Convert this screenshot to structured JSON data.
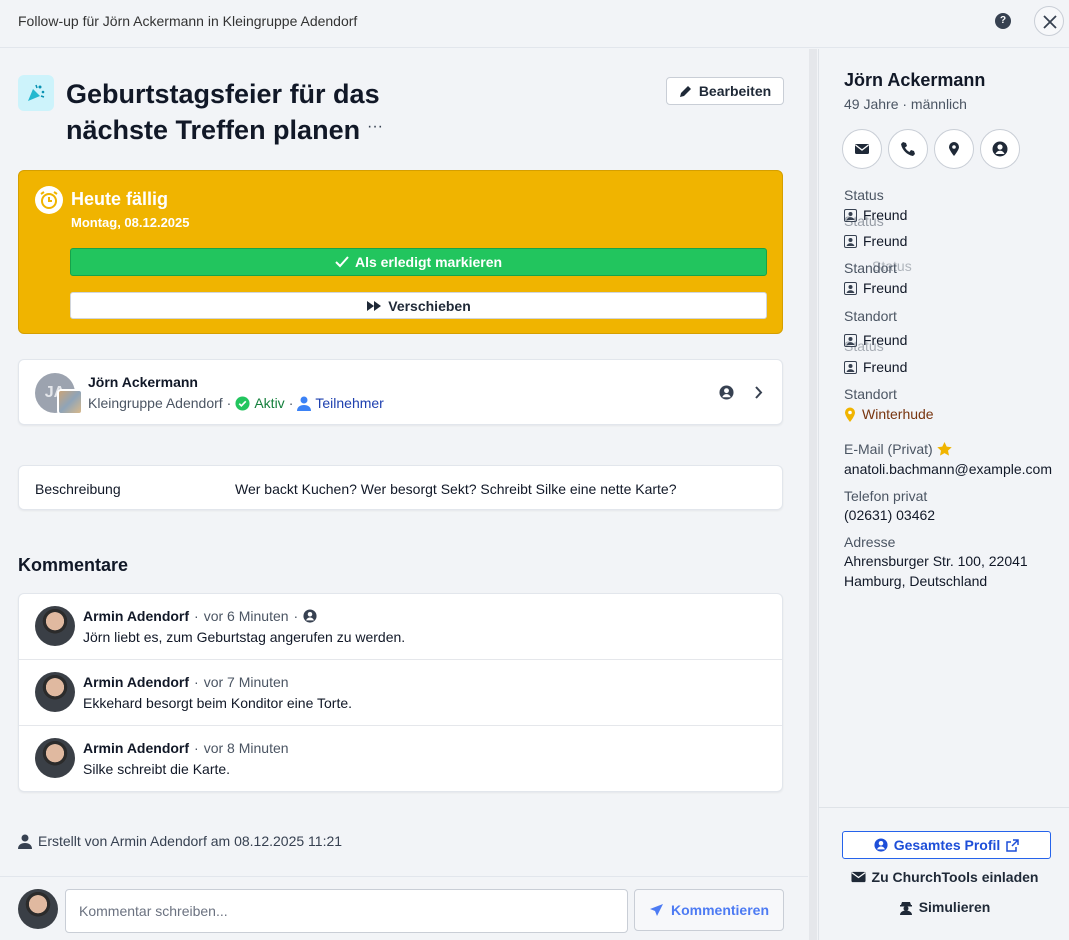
{
  "window": {
    "title": "Follow-up für Jörn Ackermann in Kleingruppe Adendorf",
    "help_glyph": "?"
  },
  "task": {
    "title": "Geburtstagsfeier für das nächste Treffen planen",
    "more_glyph": "···",
    "edit_label": "Bearbeiten",
    "due": {
      "heading": "Heute fällig",
      "date": "Montag, 08.12.2025",
      "done_label": "Als erledigt markieren",
      "postpone_label": "Verschieben",
      "color": "#f0b400"
    }
  },
  "person_card": {
    "initials": "JA",
    "name": "Jörn Ackermann",
    "group": "Kleingruppe Adendorf",
    "status": "Aktiv",
    "role": "Teilnehmer",
    "sep": "·"
  },
  "description": {
    "label": "Beschreibung",
    "value": "Wer backt Kuchen? Wer besorgt Sekt? Schreibt Silke eine nette Karte?"
  },
  "comments": {
    "heading": "Kommentare",
    "items": [
      {
        "author": "Armin Adendorf",
        "time": "vor 6 Minuten",
        "text": "Jörn liebt es, zum Geburtstag angerufen zu werden."
      },
      {
        "author": "Armin Adendorf",
        "time": "vor 7 Minuten",
        "text": "Ekkehard besorgt beim Konditor eine Torte."
      },
      {
        "author": "Armin Adendorf",
        "time": "vor 8 Minuten",
        "text": "Silke schreibt die Karte."
      }
    ],
    "sep": "·"
  },
  "created": "Erstellt von Armin Adendorf am 08.12.2025 11:21",
  "composer": {
    "placeholder": "Kommentar schreiben...",
    "submit_label": "Kommentieren"
  },
  "sidebar": {
    "name": "Jörn Ackermann",
    "subtitle": "49 Jahre · männlich",
    "labels": {
      "status": "Status",
      "standort": "Standort"
    },
    "rel_value": "Freund",
    "location": "Winterhude",
    "email_label": "E-Mail (Privat)",
    "email": "anatoli.bachmann@example.com",
    "phone_label": "Telefon privat",
    "phone": "(02631) 03462",
    "address_label": "Adresse",
    "address_line1": "Ahrensburger Str. 100, 22041",
    "address_line2": "Hamburg, Deutschland",
    "profile_label": "Gesamtes Profil",
    "invite_label": "Zu ChurchTools einladen",
    "simulate_label": "Simulieren"
  }
}
